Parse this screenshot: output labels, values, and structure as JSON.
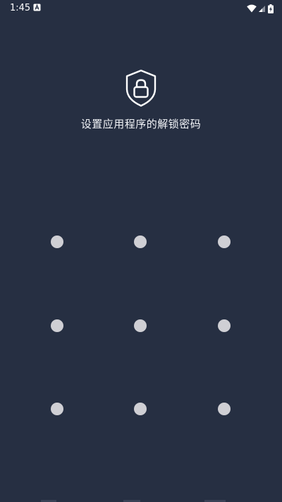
{
  "status_bar": {
    "time": "1:45",
    "notification_icon": "accessibility-a-icon",
    "wifi_icon": "wifi-icon",
    "signal_icon": "cell-signal-icon",
    "battery_icon": "battery-charging-icon"
  },
  "lock_screen": {
    "icon": "shield-lock-icon",
    "title": "设置应用程序的解锁密码"
  },
  "pattern": {
    "rows": 3,
    "cols": 3,
    "dot_color": "#cfcfd4"
  },
  "colors": {
    "background": "#262f42",
    "text": "#ffffff"
  }
}
